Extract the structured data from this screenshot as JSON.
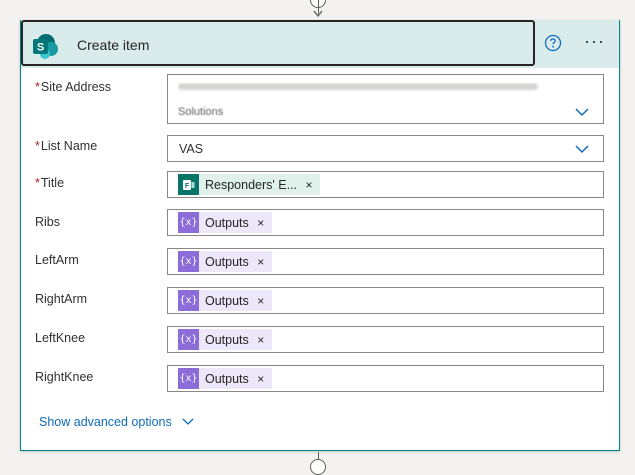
{
  "header": {
    "title": "Create item",
    "logo_letter": "S",
    "more_label": "···"
  },
  "fields": {
    "site_address": {
      "label": "Site Address",
      "required": true,
      "value_visible": "Solutions"
    },
    "list_name": {
      "label": "List Name",
      "required": true,
      "value": "VAS"
    },
    "title": {
      "label": "Title",
      "required": true,
      "token": "Responders' E...",
      "token_icon": "excel-forms-icon"
    },
    "ribs": {
      "label": "Ribs",
      "required": false,
      "token": "Outputs",
      "token_icon": "expression-icon"
    },
    "leftarm": {
      "label": "LeftArm",
      "required": false,
      "token": "Outputs",
      "token_icon": "expression-icon"
    },
    "rightarm": {
      "label": "RightArm",
      "required": false,
      "token": "Outputs",
      "token_icon": "expression-icon"
    },
    "leftknee": {
      "label": "LeftKnee",
      "required": false,
      "token": "Outputs",
      "token_icon": "expression-icon"
    },
    "rightknee": {
      "label": "RightKnee",
      "required": false,
      "token": "Outputs",
      "token_icon": "expression-icon"
    }
  },
  "required_marker": "*",
  "token_close": "×",
  "advanced_label": "Show advanced options",
  "colors": {
    "header_bg": "#d9eceb",
    "accent": "#038387",
    "link": "#0f6cbd",
    "expr_token_bg": "#ede7fa",
    "expr_icon": "#8c6cd9",
    "excel_token_bg": "#e0f1ec"
  }
}
